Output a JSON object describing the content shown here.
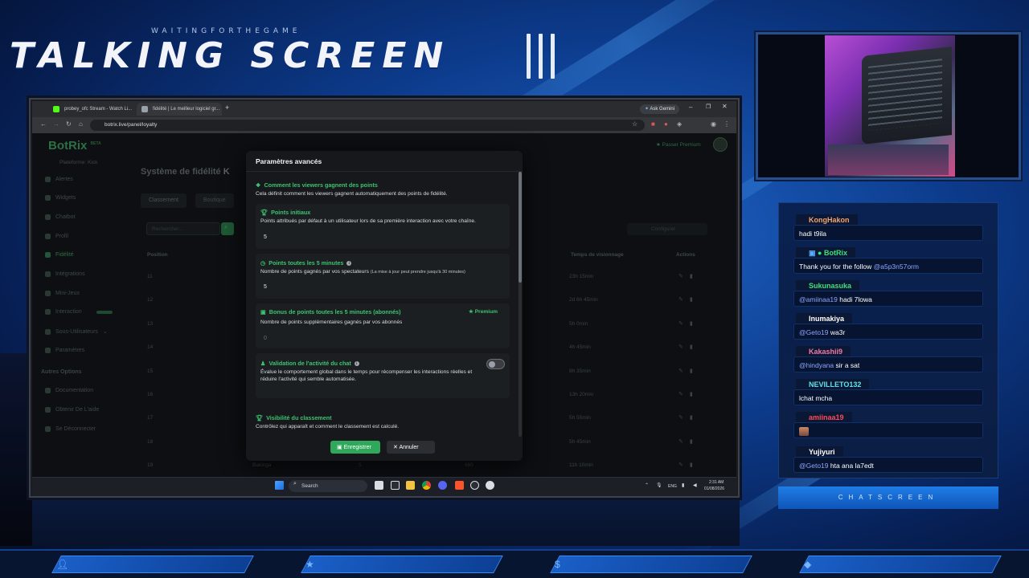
{
  "overlay": {
    "subtitle": "WAITINGFORTHEGAME",
    "title": "TALKING SCREEN",
    "chat_label": "CHATSCREEN"
  },
  "browser": {
    "tabs": [
      {
        "label": "probey_ofc Stream - Watch Li..."
      },
      {
        "label": "fidélité | Le meilleur logiciel gr..."
      }
    ],
    "ask_gemini": "Ask Gemini",
    "url": "botrix.live/panel/loyalty"
  },
  "app": {
    "logo": "BotRix",
    "logo_badge": "BETA",
    "platform": "Plateforme: Kick",
    "premium_link": "Passer Premium",
    "page_title": "Système de fidélité",
    "tabs": [
      "Classement",
      "Boutique"
    ],
    "search_placeholder": "Rechercher...",
    "sidebar": [
      "Alertes",
      "Widgets",
      "Chatbot",
      "Profil",
      "Fidélité",
      "Intégrations",
      "Mini-Jeux",
      "Interaction",
      "Sous-Utilisateurs",
      "Paramètres"
    ],
    "sidebar_section": "Autres Options",
    "sidebar_other": [
      "Documentation",
      "Obtenir De L'aide",
      "Se Déconnecter"
    ],
    "columns": {
      "position": "Position",
      "watchtime": "Temps de visionnage",
      "actions": "Actions"
    },
    "filter": "Configurer",
    "rows": [
      {
        "pos": "11",
        "time": "23h 15min"
      },
      {
        "pos": "12",
        "time": "2d 6h 45min"
      },
      {
        "pos": "13",
        "time": "5h 0min"
      },
      {
        "pos": "14",
        "time": "4h 45min"
      },
      {
        "pos": "15",
        "time": "8h 35min"
      },
      {
        "pos": "16",
        "time": "13h 20min"
      },
      {
        "pos": "17",
        "time": "5h 55min"
      },
      {
        "pos": "18",
        "time": "5h 45min"
      },
      {
        "pos": "19",
        "time": "11h 10min"
      }
    ],
    "last_row": {
      "name": "Bakinga",
      "points": "5",
      "extra": "665"
    }
  },
  "modal": {
    "title": "Paramètres avancés",
    "section1": {
      "title": "Comment les viewers gagnent des points",
      "desc": "Cela définit comment les viewers gagnent automatiquement des points de fidélité."
    },
    "initial_points": {
      "title": "Points initiaux",
      "desc": "Points attribués par défaut à un utilisateur lors de sa première interaction avec votre chaîne.",
      "value": "5"
    },
    "points_5min": {
      "title": "Points toutes les 5 minutes",
      "desc": "Nombre de points gagnés par vos spectateurs",
      "note": "(La mise à jour peut prendre jusqu'à 30 minutes)",
      "value": "5"
    },
    "bonus_subs": {
      "title": "Bonus de points toutes les 5 minutes (abonnés)",
      "badge": "Premium",
      "desc": "Nombre de points supplémentaires gagnés par vos abonnés",
      "value": "0"
    },
    "chat_validation": {
      "title": "Validation de l'activité du chat",
      "desc": "Évalue le comportement global dans le temps pour récompenser les interactions réelles et réduire l'activité qui semble automatisée.",
      "enabled": false
    },
    "visibility": {
      "title": "Visibilité du classement",
      "desc": "Contrôlez qui apparaît et comment le classement est calculé."
    },
    "save": "Enregistrer",
    "cancel": "Annuler"
  },
  "taskbar": {
    "search": "Search",
    "lang": "ENG",
    "time": "2:31 AM",
    "date": "01/08/2026"
  },
  "chat": [
    {
      "user": "KongHakon",
      "color": "#f2a36b",
      "message": "hadi t9ila",
      "mention": ""
    },
    {
      "user": "BotRix",
      "color": "#3ee07a",
      "message": "Thank you for the follow ",
      "mention": "@a5p3n57orm"
    },
    {
      "user": "Sukunasuka",
      "color": "#3ee07a",
      "message": " hadi 7lowa",
      "mention": "@amiinaa19"
    },
    {
      "user": "Inumakiya",
      "color": "#ffffff",
      "message": " wa3r",
      "mention": "@Geto19"
    },
    {
      "user": "Kakashii9",
      "color": "#f07aa8",
      "message": " sir a sat",
      "mention": "@hindyana"
    },
    {
      "user": "NEVILLETO132",
      "color": "#62e0e8",
      "message": "lchat mcha",
      "mention": ""
    },
    {
      "user": "amiinaa19",
      "color": "#ff4a5a",
      "message": "",
      "mention": ""
    },
    {
      "user": "Yujiyuri",
      "color": "#ffffff",
      "message": " hta ana la7edt",
      "mention": "@Geto19"
    }
  ],
  "colors": {
    "accent": "#3ec26f",
    "overlay_blue": "#1e64c8"
  }
}
